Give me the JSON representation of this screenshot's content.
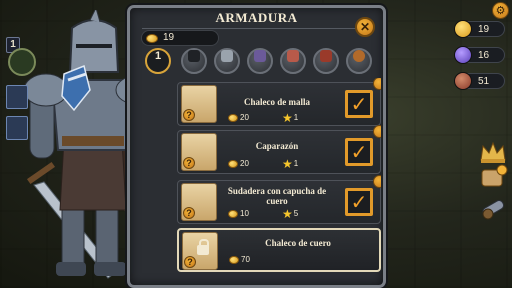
{
  "panel": {
    "title": "ARMADURA",
    "coins": "19"
  },
  "hud_left": {
    "level": "1"
  },
  "categories": [
    {
      "label": "1",
      "active": true,
      "icon": "armor-level-icon"
    },
    {
      "label": "",
      "active": false,
      "icon": "shield-dark-icon"
    },
    {
      "label": "",
      "active": false,
      "icon": "helmet-icon"
    },
    {
      "label": "",
      "active": false,
      "icon": "gauntlet-icon"
    },
    {
      "label": "",
      "active": false,
      "icon": "skull-mask-icon"
    },
    {
      "label": "",
      "active": false,
      "icon": "red-hood-icon"
    },
    {
      "label": "",
      "active": false,
      "icon": "round-shield-icon"
    }
  ],
  "items": [
    {
      "name": "Chaleco de malla",
      "price": "20",
      "stars": "1",
      "checked": true,
      "locked": false
    },
    {
      "name": "Caparazón",
      "price": "20",
      "stars": "1",
      "checked": true,
      "locked": false
    },
    {
      "name": "Sudadera con capucha de cuero",
      "price": "10",
      "stars": "5",
      "checked": true,
      "locked": false
    },
    {
      "name": "Chaleco de cuero",
      "price": "70",
      "stars": "",
      "checked": false,
      "locked": true
    }
  ],
  "hud_right": {
    "gold": "19",
    "gems": "16",
    "potions": "51"
  },
  "colors": {
    "accent": "#e29a2a",
    "coin": "#f2b338",
    "panel": "#2b2e33"
  }
}
